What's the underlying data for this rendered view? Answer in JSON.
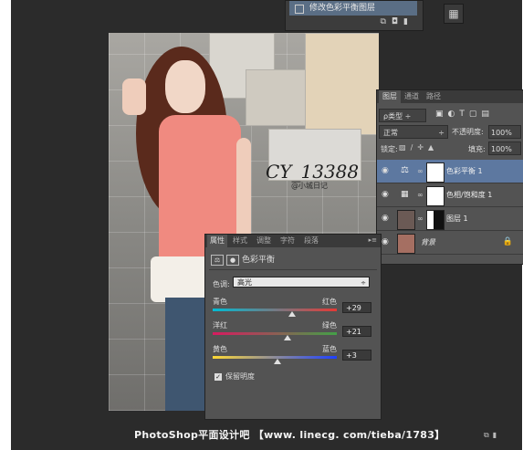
{
  "history": {
    "step_label": "修改色彩平衡图层"
  },
  "photo": {
    "signature": "CY_13388",
    "signature_sub": "@小城日记"
  },
  "layers_panel": {
    "tabs": [
      "图层",
      "通道",
      "路径"
    ],
    "kind_label": "ρ类型",
    "blend_mode": "正常",
    "opacity_label": "不透明度:",
    "opacity_value": "100%",
    "lock_label": "锁定:",
    "fill_label": "填充:",
    "fill_value": "100%",
    "layers": [
      {
        "name": "色彩平衡 1",
        "selected": true
      },
      {
        "name": "色相/饱和度 1",
        "selected": false
      },
      {
        "name": "图层 1",
        "selected": false
      },
      {
        "name": "背景",
        "selected": false
      }
    ]
  },
  "properties_panel": {
    "tabs": [
      "属性",
      "样式",
      "调整",
      "字符",
      "段落"
    ],
    "title": "色彩平衡",
    "tone_label": "色调:",
    "tone_value": "高光",
    "sliders": [
      {
        "left": "青色",
        "right": "红色",
        "value": "+29",
        "gradient": [
          "#00bcd4",
          "#e53935"
        ],
        "fraction": 0.64
      },
      {
        "left": "洋红",
        "right": "绿色",
        "value": "+21",
        "gradient": [
          "#d81b60",
          "#43a047"
        ],
        "fraction": 0.6
      },
      {
        "left": "黄色",
        "right": "蓝色",
        "value": "+3",
        "gradient": [
          "#fdd835",
          "#1e40ff"
        ],
        "fraction": 0.52
      }
    ],
    "preserve_label": "保留明度",
    "preserve_checked": true
  },
  "watermark": "PhotoShop平面设计吧 【www. linecg. com/tieba/1783】"
}
